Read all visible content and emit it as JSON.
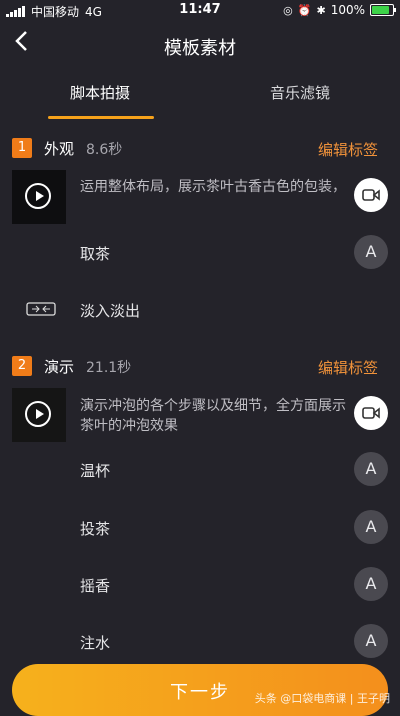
{
  "status_bar": {
    "carrier": "中国移动",
    "network": "4G",
    "time": "11:47",
    "battery": "100%"
  },
  "header": {
    "title": "模板素材",
    "back_icon": "chevron-left-icon"
  },
  "tabs": [
    {
      "label": "脚本拍摄",
      "active": true
    },
    {
      "label": "音乐滤镜",
      "active": false
    }
  ],
  "sections": [
    {
      "number": "1",
      "name": "外观",
      "duration": "8.6秒",
      "edit_label": "编辑标签",
      "description": "运用整体布局，展示茶叶古香古色的包装，",
      "rows": [
        {
          "label": "取茶",
          "button": "A"
        },
        {
          "label": "淡入淡出"
        }
      ]
    },
    {
      "number": "2",
      "name": "演示",
      "duration": "21.1秒",
      "edit_label": "编辑标签",
      "description": "演示冲泡的各个步骤以及细节，全方面展示茶叶的冲泡效果",
      "rows": [
        {
          "label": "温杯",
          "button": "A"
        },
        {
          "label": "投茶",
          "button": "A"
        },
        {
          "label": "摇香",
          "button": "A"
        },
        {
          "label": "注水",
          "button": "A"
        }
      ]
    }
  ],
  "next_button": "下一步",
  "watermark": "头条 @口袋电商课 | 王子明",
  "colors": {
    "accent": "#f6a21b",
    "edit": "#f0923a",
    "background": "#24232a"
  }
}
